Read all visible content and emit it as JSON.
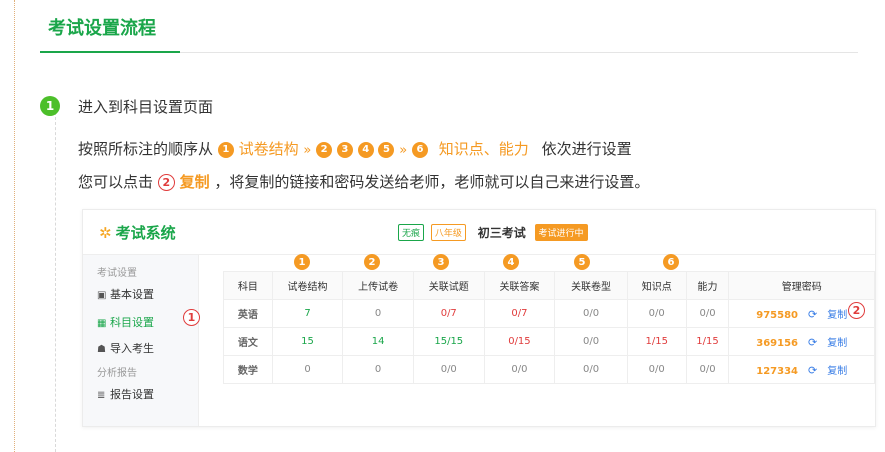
{
  "page": {
    "title": "考试设置流程"
  },
  "step1": {
    "num": "1",
    "title": "进入到科目设置页面",
    "line1": {
      "prefix": "按照所标注的顺序从",
      "c1": "1",
      "exam_structure": "试卷结构",
      "arrow": "»",
      "c2": "2",
      "c3": "3",
      "c4": "4",
      "c5": "5",
      "c6": "6",
      "highlight": "知识点、能力",
      "suffix": "依次进行设置"
    },
    "line2": {
      "prefix": "您可以点击",
      "c": "2",
      "copy": "复制",
      "suffix": "，将复制的链接和密码发送给老师，老师就可以自己来进行设置。"
    }
  },
  "mock": {
    "logo": "考试系统",
    "tag_none": "无痕",
    "tag_grade": "八年级",
    "exam_name": "初三考试",
    "status": "考试进行中",
    "sidebar": {
      "section1": "考试设置",
      "item_basic": "基本设置",
      "item_subject": "科目设置",
      "item_import": "导入考生",
      "section2": "分析报告",
      "item_report": "报告设置"
    },
    "markers": {
      "m1": "1",
      "c1": "1",
      "c2": "2",
      "c3": "3",
      "c4": "4",
      "c5": "5",
      "c6": "6",
      "m2": "2"
    },
    "table": {
      "headers": [
        "科目",
        "试卷结构",
        "上传试卷",
        "关联试题",
        "关联答案",
        "关联卷型",
        "知识点",
        "能力",
        "管理密码"
      ],
      "copy_label": "复制",
      "rows": [
        {
          "subject": "英语",
          "structure": "7",
          "upload": "0",
          "questions": "0/7",
          "answers": "0/7",
          "paper_type": "0/0",
          "knowledge": "0/0",
          "ability": "0/0",
          "password": "975580"
        },
        {
          "subject": "语文",
          "structure": "15",
          "upload": "14",
          "questions": "15/15",
          "answers": "0/15",
          "paper_type": "0/0",
          "knowledge": "1/15",
          "ability": "1/15",
          "password": "369156"
        },
        {
          "subject": "数学",
          "structure": "0",
          "upload": "0",
          "questions": "0/0",
          "answers": "0/0",
          "paper_type": "0/0",
          "knowledge": "0/0",
          "ability": "0/0",
          "password": "127334"
        }
      ]
    }
  },
  "colors": {
    "green": "#1aa64a",
    "orange": "#f59a23",
    "red": "#e03c3c",
    "blue": "#3a7ee6"
  },
  "icons": [
    "sparkle-logo-icon",
    "id-card-icon",
    "calendar-icon",
    "users-icon",
    "report-icon",
    "refresh-icon"
  ]
}
